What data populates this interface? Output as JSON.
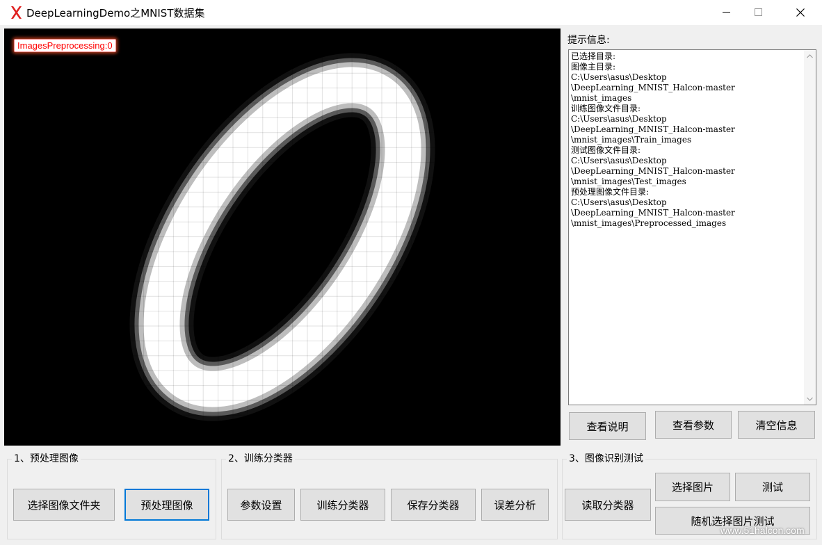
{
  "window": {
    "title": "DeepLearningDemo之MNIST数据集",
    "icon": "app-x-icon",
    "controls": [
      "minimize-icon",
      "maximize-icon",
      "close-icon"
    ]
  },
  "image_view": {
    "overlay_label": "ImagesPreprocessing:0"
  },
  "info_panel": {
    "label": "提示信息:",
    "lines": [
      "已选择目录:",
      "图像主目录:",
      "C:\\Users\\asus\\Desktop",
      "\\DeepLearning_MNIST_Halcon-master",
      "\\mnist_images",
      "训练图像文件目录:",
      "C:\\Users\\asus\\Desktop",
      "\\DeepLearning_MNIST_Halcon-master",
      "\\mnist_images\\Train_images",
      "测试图像文件目录:",
      "C:\\Users\\asus\\Desktop",
      "\\DeepLearning_MNIST_Halcon-master",
      "\\mnist_images\\Test_images",
      "预处理图像文件目录:",
      "C:\\Users\\asus\\Desktop",
      "\\DeepLearning_MNIST_Halcon-master",
      "\\mnist_images\\Preprocessed_images"
    ],
    "buttons": {
      "view_help": "查看说明",
      "view_params": "查看参数",
      "clear_info": "清空信息"
    }
  },
  "groups": {
    "preprocess": {
      "title": "1、预处理图像",
      "select_folder": "选择图像文件夹",
      "preprocess": "预处理图像"
    },
    "train": {
      "title": "2、训练分类器",
      "param_settings": "参数设置",
      "train_classifier": "训练分类器",
      "save_classifier": "保存分类器",
      "error_analysis": "误差分析"
    },
    "test": {
      "title": "3、图像识别测试",
      "read_classifier": "读取分类器",
      "select_image": "选择图片",
      "test": "测试",
      "random_test": "随机选择图片测试"
    }
  },
  "watermark": "www.51halcon.com"
}
